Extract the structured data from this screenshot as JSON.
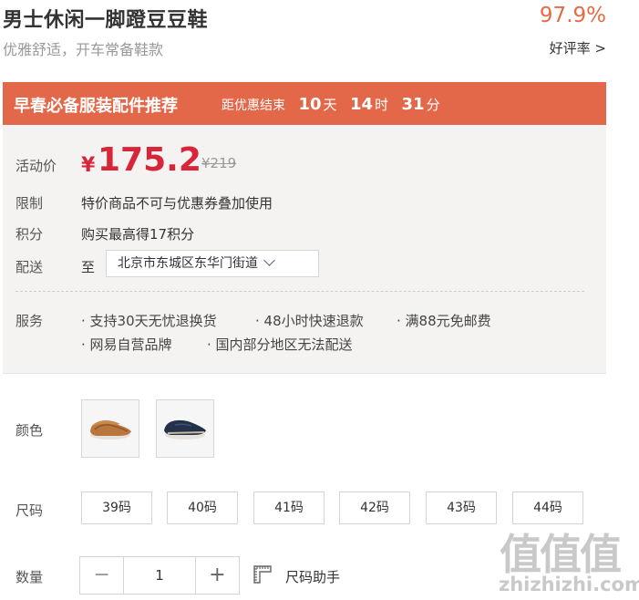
{
  "product": {
    "title": "男士休闲一脚蹬豆豆鞋",
    "subtitle": "优雅舒适，开车常备鞋款",
    "rating_percent": "97.9%",
    "rating_label": "好评率 >"
  },
  "promo": {
    "title": "早春必备服装配件推荐",
    "countdown_label": "距优惠结束",
    "days": "10",
    "days_unit": "天",
    "hours": "14",
    "hours_unit": "时",
    "minutes": "31",
    "minutes_unit": "分"
  },
  "price": {
    "label": "活动价",
    "currency": "¥",
    "current": "175.2",
    "original": "¥219"
  },
  "limit": {
    "label": "限制",
    "text": "特价商品不可与优惠券叠加使用"
  },
  "points": {
    "label": "积分",
    "text": "购买最高得17积分"
  },
  "shipping": {
    "label": "配送",
    "to": "至",
    "location": "北京市东城区东华门街道"
  },
  "services": {
    "label": "服务",
    "items": [
      "· 支持30天无忧退换货",
      "· 48小时快速退款",
      "· 满88元免邮费",
      "· 网易自营品牌",
      "· 国内部分地区无法配送"
    ]
  },
  "color": {
    "label": "颜色"
  },
  "size": {
    "label": "尺码",
    "options": [
      "39码",
      "40码",
      "41码",
      "42码",
      "43码",
      "44码"
    ]
  },
  "quantity": {
    "label": "数量",
    "minus": "−",
    "value": "1",
    "plus": "+",
    "size_helper": "尺码助手"
  },
  "watermark": {
    "logo": "值值值",
    "site": "zhizhizhi.com"
  },
  "colors": {
    "accent": "#e3684a",
    "price_red": "#d7263a",
    "rating": "#e56b48"
  }
}
